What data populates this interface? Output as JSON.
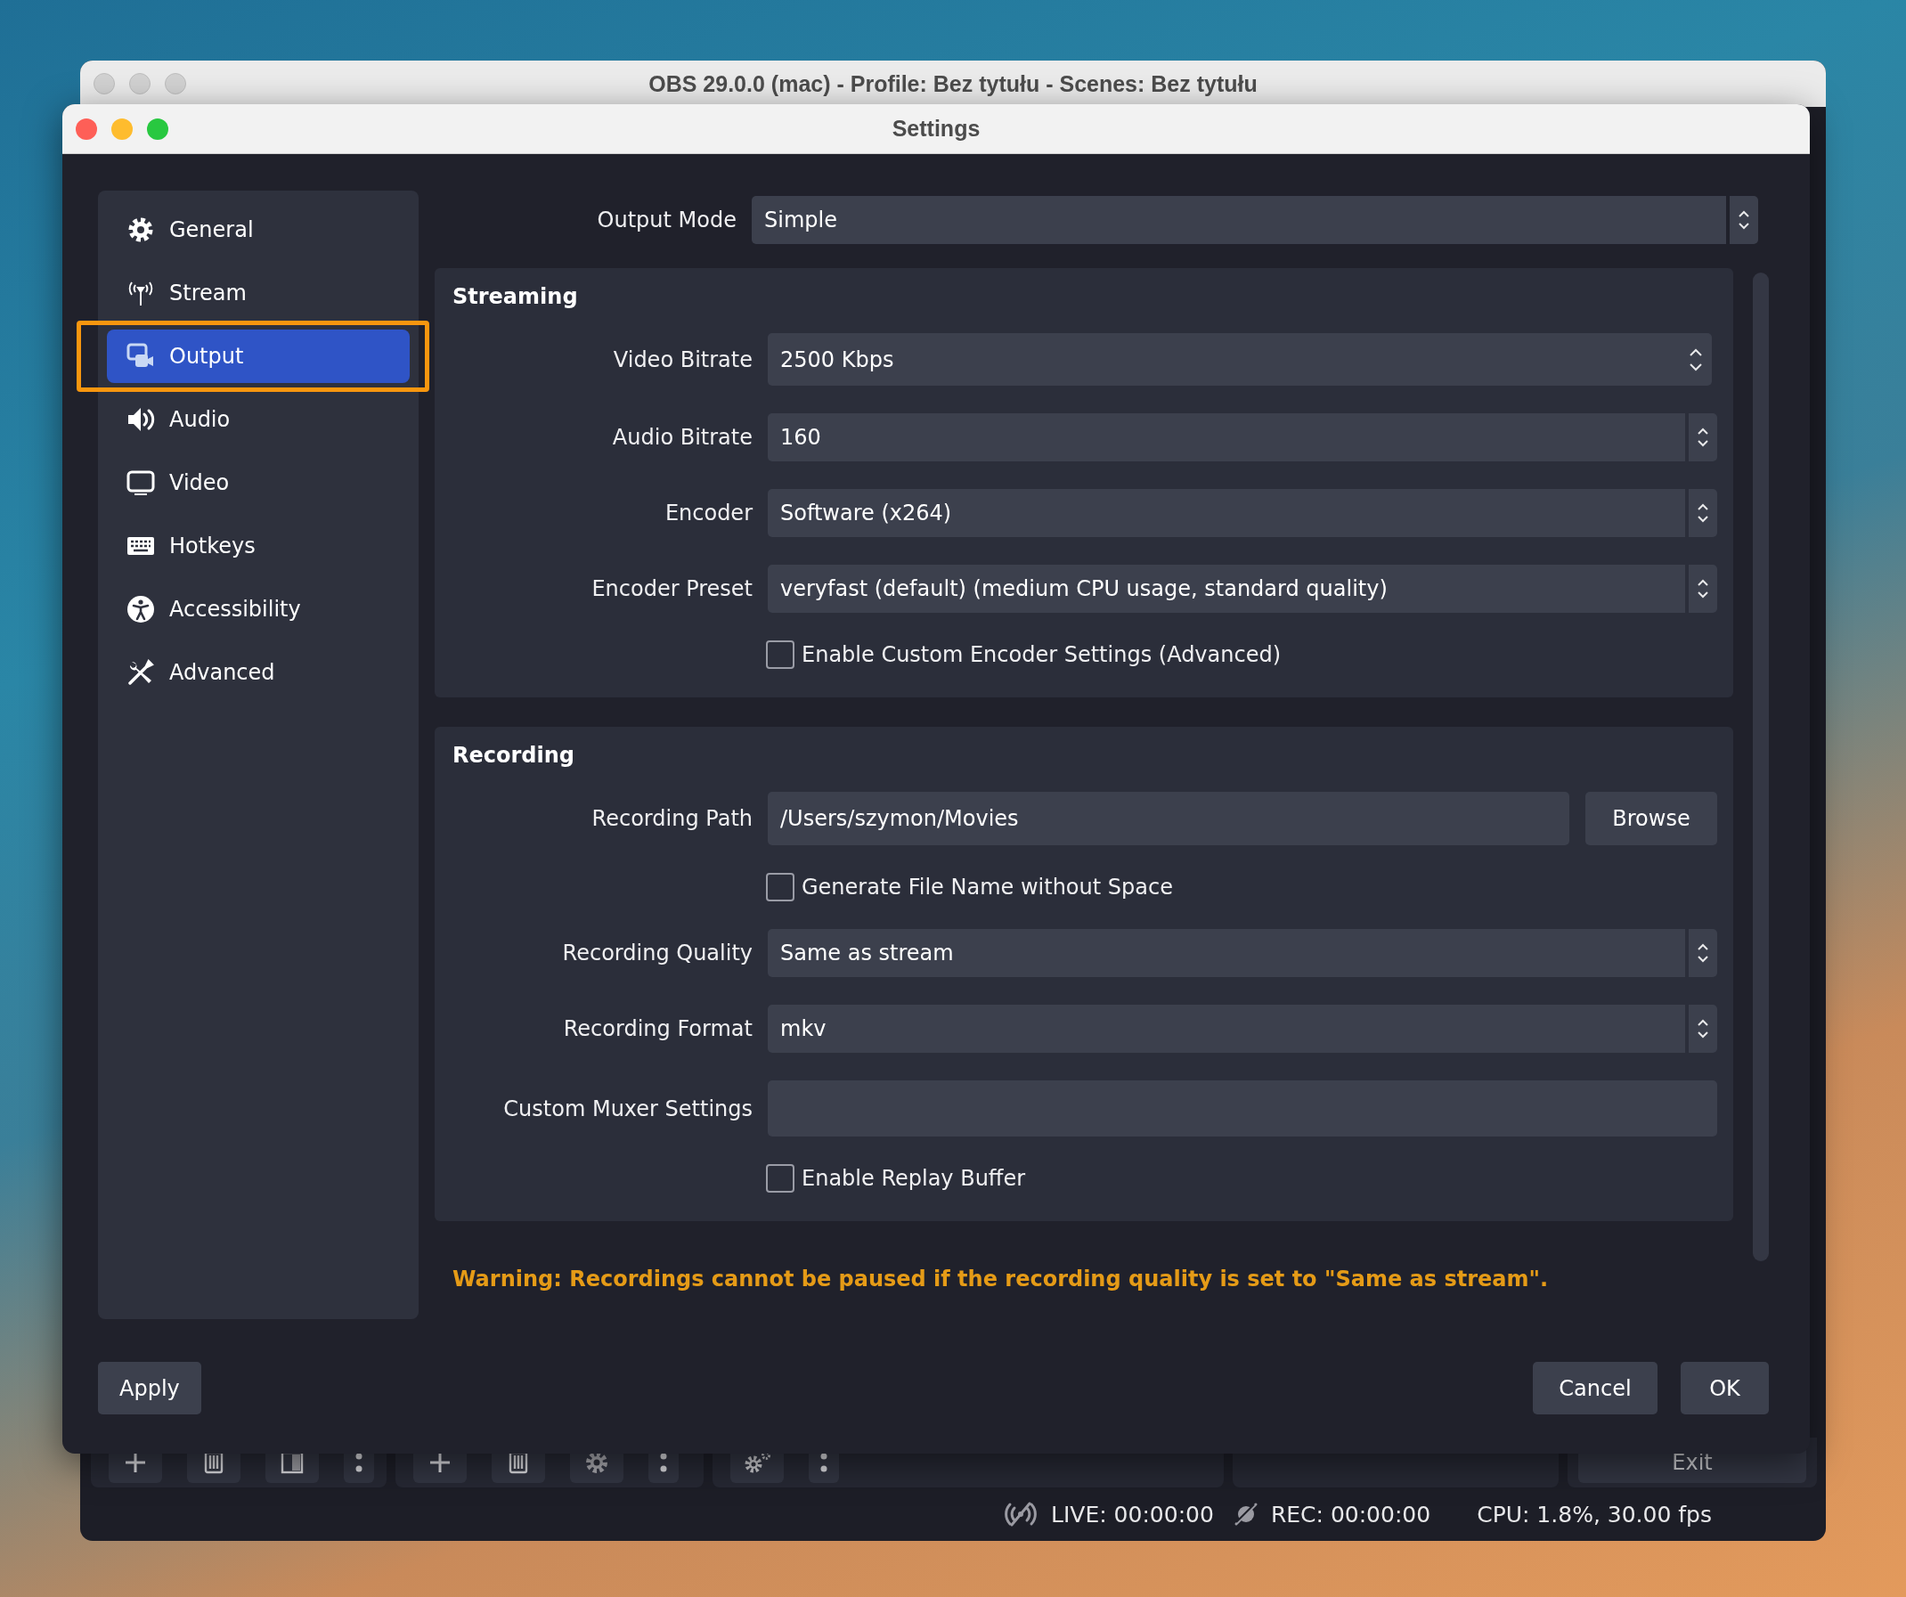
{
  "main_window": {
    "title": "OBS 29.0.0 (mac) - Profile: Bez tytułu - Scenes: Bez tytułu",
    "docks": [
      {
        "buttons": [
          {
            "kind": "plus"
          },
          {
            "kind": "trash"
          },
          {
            "kind": "filter"
          },
          {
            "kind": "dots"
          }
        ]
      },
      {
        "buttons": [
          {
            "kind": "plus"
          },
          {
            "kind": "trash"
          },
          {
            "kind": "gear"
          },
          {
            "kind": "dots"
          }
        ]
      },
      {
        "buttons": [
          {
            "kind": "gears"
          },
          {
            "kind": "dots"
          }
        ]
      }
    ],
    "exit_button": "Exit",
    "status_bar": {
      "live": "LIVE: 00:00:00",
      "rec": "REC: 00:00:00",
      "cpu": "CPU: 1.8%, 30.00 fps"
    }
  },
  "settings_window": {
    "title": "Settings"
  },
  "sidebar": {
    "items": [
      {
        "kind": "gear",
        "label": "General",
        "selected": false,
        "outlined": false
      },
      {
        "kind": "antenna",
        "label": "Stream",
        "selected": false,
        "outlined": false
      },
      {
        "kind": "output",
        "label": "Output",
        "selected": true,
        "outlined": true
      },
      {
        "kind": "speaker",
        "label": "Audio",
        "selected": false,
        "outlined": false
      },
      {
        "kind": "monitor",
        "label": "Video",
        "selected": false,
        "outlined": false
      },
      {
        "kind": "keyboard",
        "label": "Hotkeys",
        "selected": false,
        "outlined": false
      },
      {
        "kind": "accessibility",
        "label": "Accessibility",
        "selected": false,
        "outlined": false
      },
      {
        "kind": "tools",
        "label": "Advanced",
        "selected": false,
        "outlined": false
      }
    ]
  },
  "output_mode": {
    "label": "Output Mode",
    "value": "Simple"
  },
  "groups": [
    {
      "title": "Streaming",
      "rows": [
        {
          "kind": "spin",
          "label": "Video Bitrate",
          "value": "2500 Kbps"
        },
        {
          "kind": "combo",
          "label": "Audio Bitrate",
          "value": "160"
        },
        {
          "kind": "combo",
          "label": "Encoder",
          "value": "Software (x264)"
        },
        {
          "kind": "combo",
          "label": "Encoder Preset",
          "value": "veryfast (default) (medium CPU usage, standard quality)"
        },
        {
          "kind": "checkbox",
          "label": "Enable Custom Encoder Settings (Advanced)",
          "checked": false
        }
      ]
    },
    {
      "title": "Recording",
      "rows": [
        {
          "kind": "path",
          "label": "Recording Path",
          "value": "/Users/szymon/Movies",
          "button": "Browse"
        },
        {
          "kind": "checkbox",
          "label": "Generate File Name without Space",
          "checked": false
        },
        {
          "kind": "combo",
          "label": "Recording Quality",
          "value": "Same as stream"
        },
        {
          "kind": "combo",
          "label": "Recording Format",
          "value": "mkv"
        },
        {
          "kind": "text",
          "label": "Custom Muxer Settings"
        },
        {
          "kind": "checkbox",
          "label": "Enable Replay Buffer",
          "checked": false
        }
      ]
    }
  ],
  "warning": "Warning: Recordings cannot be paused if the recording quality is set to \"Same as stream\".",
  "buttons": {
    "apply": "Apply",
    "cancel": "Cancel",
    "ok": "OK"
  }
}
